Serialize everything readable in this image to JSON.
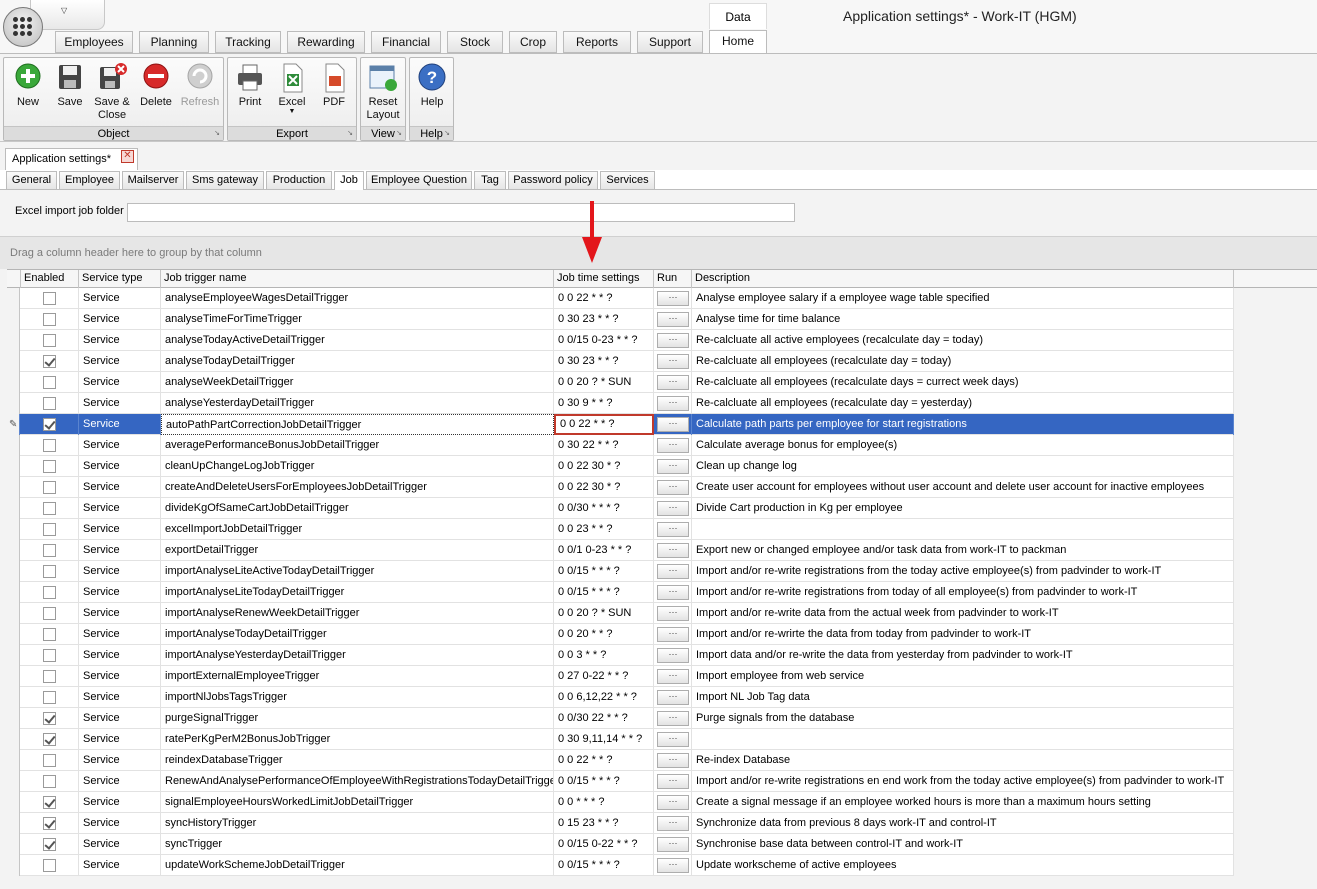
{
  "app": {
    "title": "Application settings* - Work-IT (HGM)",
    "context_tab": "Data",
    "quick_access_arrow": "▽"
  },
  "menu_tabs": [
    "Employees",
    "Planning",
    "Tracking",
    "Rewarding",
    "Financial",
    "Stock",
    "Crop",
    "Reports",
    "Support",
    "Home"
  ],
  "active_menu_tab": "Home",
  "ribbon": {
    "object": {
      "label": "Object",
      "buttons": [
        "New",
        "Save",
        "Save & Close",
        "Delete",
        "Refresh"
      ]
    },
    "export": {
      "label": "Export",
      "buttons": [
        "Print",
        "Excel",
        "PDF"
      ]
    },
    "view": {
      "label": "View",
      "buttons": [
        "Reset Layout"
      ]
    },
    "help": {
      "label": "Help",
      "buttons": [
        "Help"
      ]
    },
    "disabled": [
      "Refresh"
    ]
  },
  "document_tab": {
    "title": "Application settings*",
    "close_glyph": "✕"
  },
  "settings_tabs": [
    "General",
    "Employee",
    "Mailserver",
    "Sms gateway",
    "Production",
    "Job",
    "Employee Question",
    "Tag",
    "Password policy",
    "Services"
  ],
  "active_settings_tab": "Job",
  "excel_import": {
    "label": "Excel import job folder",
    "value": ""
  },
  "group_panel": {
    "text": "Drag a column header here to group by that column"
  },
  "grid": {
    "columns": [
      "Enabled",
      "Service type",
      "Job trigger name",
      "Job time settings",
      "Run",
      "Description"
    ],
    "run_glyph": "···",
    "edit_glyph": "✎",
    "selected_row": 6,
    "rows": [
      {
        "enabled": false,
        "type": "Service",
        "name": "analyseEmployeeWagesDetailTrigger",
        "time": "0 0 22 * * ?",
        "desc": "Analyse employee salary if a employee wage table specified"
      },
      {
        "enabled": false,
        "type": "Service",
        "name": "analyseTimeForTimeTrigger",
        "time": "0 30 23 * * ?",
        "desc": "Analyse time for time balance"
      },
      {
        "enabled": false,
        "type": "Service",
        "name": "analyseTodayActiveDetailTrigger",
        "time": "0 0/15 0-23 * * ?",
        "desc": "Re-calcluate all active employees (recalculate day = today)"
      },
      {
        "enabled": true,
        "type": "Service",
        "name": "analyseTodayDetailTrigger",
        "time": "0 30 23 * * ?",
        "desc": "Re-calcluate all employees (recalculate day = today)"
      },
      {
        "enabled": false,
        "type": "Service",
        "name": "analyseWeekDetailTrigger",
        "time": "0 0 20 ? * SUN",
        "desc": "Re-calcluate all employees (recalculate days = currect week days)"
      },
      {
        "enabled": false,
        "type": "Service",
        "name": "analyseYesterdayDetailTrigger",
        "time": "0 30 9 * * ?",
        "desc": "Re-calcluate all employees (recalculate day = yesterday)"
      },
      {
        "enabled": true,
        "type": "Service",
        "name": "autoPathPartCorrectionJobDetailTrigger",
        "time": "0 0 22 * * ?",
        "desc": "Calculate path parts per employee for start registrations"
      },
      {
        "enabled": false,
        "type": "Service",
        "name": "averagePerformanceBonusJobDetailTrigger",
        "time": "0 30 22 * * ?",
        "desc": "Calculate average bonus for employee(s)"
      },
      {
        "enabled": false,
        "type": "Service",
        "name": "cleanUpChangeLogJobTrigger",
        "time": "0 0 22 30 * ?",
        "desc": "Clean up change log"
      },
      {
        "enabled": false,
        "type": "Service",
        "name": "createAndDeleteUsersForEmployeesJobDetailTrigger",
        "time": "0 0 22 30 * ?",
        "desc": "Create user account for employees without user account and delete user account for inactive employees"
      },
      {
        "enabled": false,
        "type": "Service",
        "name": "divideKgOfSameCartJobDetailTrigger",
        "time": "0 0/30 * * * ?",
        "desc": "Divide Cart production in Kg per employee"
      },
      {
        "enabled": false,
        "type": "Service",
        "name": "excelImportJobDetailTrigger",
        "time": "0 0 23 * * ?",
        "desc": ""
      },
      {
        "enabled": false,
        "type": "Service",
        "name": "exportDetailTrigger",
        "time": "0 0/1 0-23 * * ?",
        "desc": "Export new or changed employee and/or task data from work-IT to packman"
      },
      {
        "enabled": false,
        "type": "Service",
        "name": "importAnalyseLiteActiveTodayDetailTrigger",
        "time": "0 0/15 * * * ?",
        "desc": "Import and/or re-write registrations from the today active employee(s) from padvinder to work-IT"
      },
      {
        "enabled": false,
        "type": "Service",
        "name": "importAnalyseLiteTodayDetailTrigger",
        "time": "0 0/15 * * * ?",
        "desc": "Import and/or re-write registrations from today of all employee(s) from padvinder to work-IT"
      },
      {
        "enabled": false,
        "type": "Service",
        "name": "importAnalyseRenewWeekDetailTrigger",
        "time": "0 0 20 ? * SUN",
        "desc": "Import and/or re-write data from the actual week from padvinder to work-IT"
      },
      {
        "enabled": false,
        "type": "Service",
        "name": "importAnalyseTodayDetailTrigger",
        "time": "0 0 20 * * ?",
        "desc": "Import and/or re-wrirte the data from today from padvinder to work-IT"
      },
      {
        "enabled": false,
        "type": "Service",
        "name": "importAnalyseYesterdayDetailTrigger",
        "time": "0 0 3 * * ?",
        "desc": "Import data and/or re-write the data from yesterday from padvinder to work-IT"
      },
      {
        "enabled": false,
        "type": "Service",
        "name": "importExternalEmployeeTrigger",
        "time": "0 27 0-22 * * ?",
        "desc": "Import employee from web service"
      },
      {
        "enabled": false,
        "type": "Service",
        "name": "importNlJobsTagsTrigger",
        "time": "0 0 6,12,22 * * ?",
        "desc": "Import NL Job Tag data"
      },
      {
        "enabled": true,
        "type": "Service",
        "name": "purgeSignalTrigger",
        "time": "0 0/30 22 * * ?",
        "desc": "Purge signals from the database"
      },
      {
        "enabled": true,
        "type": "Service",
        "name": "ratePerKgPerM2BonusJobTrigger",
        "time": "0 30 9,11,14 * * ?",
        "desc": ""
      },
      {
        "enabled": false,
        "type": "Service",
        "name": "reindexDatabaseTrigger",
        "time": "0 0 22 * * ?",
        "desc": "Re-index Database"
      },
      {
        "enabled": false,
        "type": "Service",
        "name": "RenewAndAnalysePerformanceOfEmployeeWithRegistrationsTodayDetailTrigger",
        "time": "0 0/15 * * * ?",
        "desc": "Import and/or re-write registrations en end work from the today active employee(s) from padvinder to work-IT"
      },
      {
        "enabled": true,
        "type": "Service",
        "name": "signalEmployeeHoursWorkedLimitJobDetailTrigger",
        "time": "0 0 * * * ?",
        "desc": "Create a signal message if an employee worked hours is more than a maximum hours setting"
      },
      {
        "enabled": true,
        "type": "Service",
        "name": "syncHistoryTrigger",
        "time": "0 15 23 * * ?",
        "desc": "Synchronize data from previous 8 days work-IT and control-IT"
      },
      {
        "enabled": true,
        "type": "Service",
        "name": "syncTrigger",
        "time": "0 0/15 0-22 * * ?",
        "desc": "Synchronise base data between control-IT and work-IT"
      },
      {
        "enabled": false,
        "type": "Service",
        "name": "updateWorkSchemeJobDetailTrigger",
        "time": "0 0/15 * * * ?",
        "desc": "Update workscheme of active employees"
      }
    ]
  },
  "colors": {
    "selection": "#3566c2",
    "highlight_border": "#c0392b",
    "annotation_arrow": "#e3161b"
  }
}
